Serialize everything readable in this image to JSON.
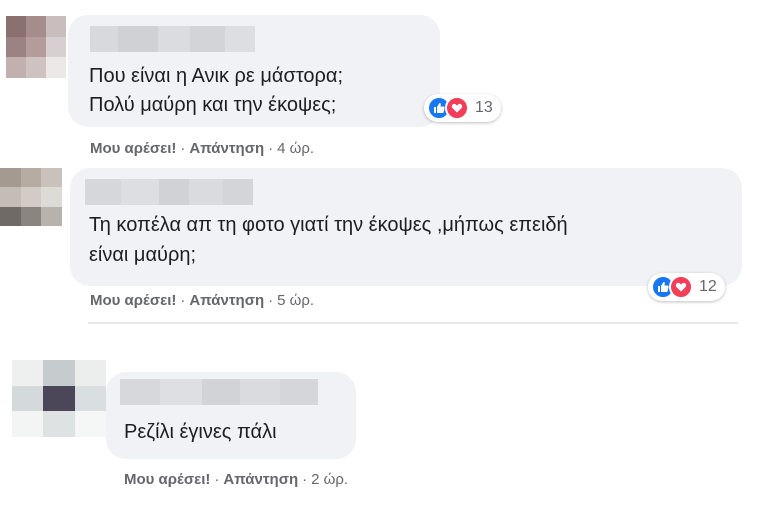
{
  "comments": [
    {
      "text_lines": [
        "Που είναι η Ανικ ρε μάστορα;",
        "Πολύ μαύρη και την έκοψες;"
      ],
      "reaction_count": "13",
      "like_label": "Μου αρέσει!",
      "reply_label": "Απάντηση",
      "time": "4 ώρ."
    },
    {
      "text_lines": [
        "Τη κοπέλα απ τη φοτο γιατί την έκοψες ,μήπως επειδή",
        "είναι μαύρη;"
      ],
      "reaction_count": "12",
      "like_label": "Μου αρέσει!",
      "reply_label": "Απάντηση",
      "time": "5 ώρ."
    },
    {
      "text_lines": [
        "Ρεζίλι έγινες πάλι"
      ],
      "like_label": "Μου αρέσει!",
      "reply_label": "Απάντηση",
      "time": "2 ώρ."
    }
  ],
  "colors": {
    "bubble": "#f0f2f5",
    "like_blue": "#1877f2",
    "love_red": "#f33e58",
    "meta_gray": "#65676b"
  }
}
